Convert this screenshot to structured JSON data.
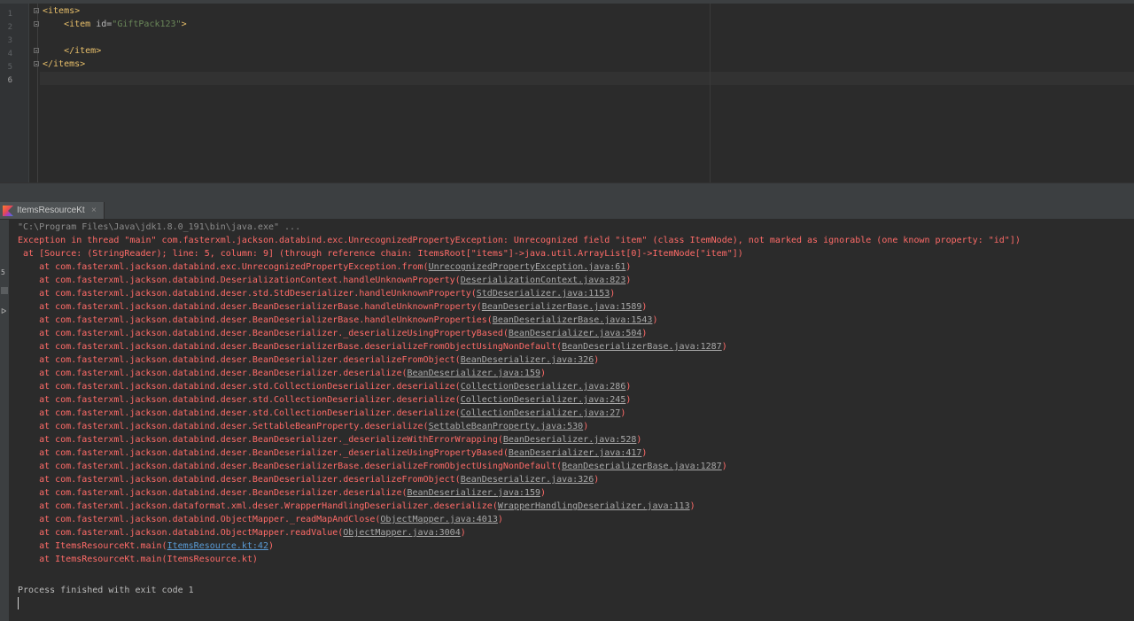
{
  "editor": {
    "line_numbers": [
      "1",
      "2",
      "3",
      "4",
      "5",
      "6"
    ],
    "lines": [
      {
        "tag_open": "<items>",
        "attr_name": "",
        "attr_eq": "",
        "attr_val": "",
        "tag_close": ""
      },
      {
        "tag_open": "    <item ",
        "attr_name": "id",
        "attr_eq": "=",
        "attr_val": "\"GiftPack123\"",
        "tag_close": ">"
      },
      {
        "tag_open": "",
        "attr_name": "",
        "attr_eq": "",
        "attr_val": "",
        "tag_close": ""
      },
      {
        "tag_open": "    </item>",
        "attr_name": "",
        "attr_eq": "",
        "attr_val": "",
        "tag_close": ""
      },
      {
        "tag_open": "</items>",
        "attr_name": "",
        "attr_eq": "",
        "attr_val": "",
        "tag_close": ""
      },
      {
        "tag_open": "",
        "attr_name": "",
        "attr_eq": "",
        "attr_val": "",
        "tag_close": ""
      }
    ]
  },
  "run_tab": {
    "label": "ItemsResourceKt",
    "icon": "kotlin-icon",
    "close": "×"
  },
  "console": {
    "command": "\"C:\\Program Files\\Java\\jdk1.8.0_191\\bin\\java.exe\" ...",
    "exception": "Exception in thread \"main\" com.fasterxml.jackson.databind.exc.UnrecognizedPropertyException: Unrecognized field \"item\" (class ItemNode), not marked as ignorable (one known property: \"id\"])",
    "source": " at [Source: (StringReader); line: 5, column: 9] (through reference chain: ItemsRoot[\"items\"]->java.util.ArrayList[0]->ItemNode[\"item\"])",
    "frames": [
      {
        "prefix": "    at com.fasterxml.jackson.databind.exc.UnrecognizedPropertyException.from(",
        "link": "UnrecognizedPropertyException.java:61",
        "suffix": ")"
      },
      {
        "prefix": "    at com.fasterxml.jackson.databind.DeserializationContext.handleUnknownProperty(",
        "link": "DeserializationContext.java:823",
        "suffix": ")"
      },
      {
        "prefix": "    at com.fasterxml.jackson.databind.deser.std.StdDeserializer.handleUnknownProperty(",
        "link": "StdDeserializer.java:1153",
        "suffix": ")"
      },
      {
        "prefix": "    at com.fasterxml.jackson.databind.deser.BeanDeserializerBase.handleUnknownProperty(",
        "link": "BeanDeserializerBase.java:1589",
        "suffix": ")"
      },
      {
        "prefix": "    at com.fasterxml.jackson.databind.deser.BeanDeserializerBase.handleUnknownProperties(",
        "link": "BeanDeserializerBase.java:1543",
        "suffix": ")"
      },
      {
        "prefix": "    at com.fasterxml.jackson.databind.deser.BeanDeserializer._deserializeUsingPropertyBased(",
        "link": "BeanDeserializer.java:504",
        "suffix": ")"
      },
      {
        "prefix": "    at com.fasterxml.jackson.databind.deser.BeanDeserializerBase.deserializeFromObjectUsingNonDefault(",
        "link": "BeanDeserializerBase.java:1287",
        "suffix": ")"
      },
      {
        "prefix": "    at com.fasterxml.jackson.databind.deser.BeanDeserializer.deserializeFromObject(",
        "link": "BeanDeserializer.java:326",
        "suffix": ")"
      },
      {
        "prefix": "    at com.fasterxml.jackson.databind.deser.BeanDeserializer.deserialize(",
        "link": "BeanDeserializer.java:159",
        "suffix": ")"
      },
      {
        "prefix": "    at com.fasterxml.jackson.databind.deser.std.CollectionDeserializer.deserialize(",
        "link": "CollectionDeserializer.java:286",
        "suffix": ")"
      },
      {
        "prefix": "    at com.fasterxml.jackson.databind.deser.std.CollectionDeserializer.deserialize(",
        "link": "CollectionDeserializer.java:245",
        "suffix": ")"
      },
      {
        "prefix": "    at com.fasterxml.jackson.databind.deser.std.CollectionDeserializer.deserialize(",
        "link": "CollectionDeserializer.java:27",
        "suffix": ")"
      },
      {
        "prefix": "    at com.fasterxml.jackson.databind.deser.SettableBeanProperty.deserialize(",
        "link": "SettableBeanProperty.java:530",
        "suffix": ")"
      },
      {
        "prefix": "    at com.fasterxml.jackson.databind.deser.BeanDeserializer._deserializeWithErrorWrapping(",
        "link": "BeanDeserializer.java:528",
        "suffix": ")"
      },
      {
        "prefix": "    at com.fasterxml.jackson.databind.deser.BeanDeserializer._deserializeUsingPropertyBased(",
        "link": "BeanDeserializer.java:417",
        "suffix": ")"
      },
      {
        "prefix": "    at com.fasterxml.jackson.databind.deser.BeanDeserializerBase.deserializeFromObjectUsingNonDefault(",
        "link": "BeanDeserializerBase.java:1287",
        "suffix": ")"
      },
      {
        "prefix": "    at com.fasterxml.jackson.databind.deser.BeanDeserializer.deserializeFromObject(",
        "link": "BeanDeserializer.java:326",
        "suffix": ")"
      },
      {
        "prefix": "    at com.fasterxml.jackson.databind.deser.BeanDeserializer.deserialize(",
        "link": "BeanDeserializer.java:159",
        "suffix": ")"
      },
      {
        "prefix": "    at com.fasterxml.jackson.dataformat.xml.deser.WrapperHandlingDeserializer.deserialize(",
        "link": "WrapperHandlingDeserializer.java:113",
        "suffix": ")"
      },
      {
        "prefix": "    at com.fasterxml.jackson.databind.ObjectMapper._readMapAndClose(",
        "link": "ObjectMapper.java:4013",
        "suffix": ")"
      },
      {
        "prefix": "    at com.fasterxml.jackson.databind.ObjectMapper.readValue(",
        "link": "ObjectMapper.java:3004",
        "suffix": ")"
      },
      {
        "prefix": "    at ItemsResourceKt.main(",
        "link": "ItemsResource.kt:42",
        "suffix": ")"
      },
      {
        "prefix": "    at ItemsResourceKt.main(ItemsResource.kt)",
        "link": "",
        "suffix": ""
      }
    ],
    "finished": "Process finished with exit code 1"
  }
}
